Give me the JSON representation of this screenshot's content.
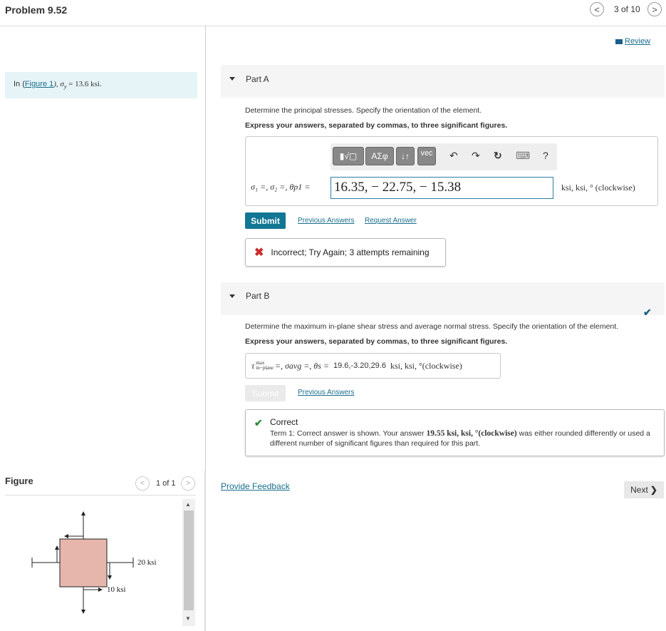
{
  "header": {
    "title": "Problem 9.52",
    "page_count": "3 of 10",
    "prev_glyph": "<",
    "next_glyph": ">"
  },
  "intro": {
    "prefix": "In (",
    "figure_link": "Figure 1",
    "suffix": "), σ",
    "sub": "y",
    "value": " = 13.6 ksi."
  },
  "review_link": "Review",
  "part_a": {
    "label": "Part A",
    "question": "Determine the principal stresses. Specify the orientation of the element.",
    "instruction": "Express your answers, separated by commas, to three significant figures.",
    "toolbar": {
      "template_btn": "▮√▢",
      "greek_btn": "ΑΣφ",
      "arrows_btn": "↓↑",
      "vec_btn": "vec",
      "undo": "↶",
      "redo": "↷",
      "reset": "↻",
      "keyboard": "⌨",
      "help": "?"
    },
    "equation_label": "σ₁ =, σ₂ =, θp1 =",
    "answer_value": "16.35, − 22.75, − 15.38",
    "units": "ksi, ksi, ° (clockwise)",
    "submit_label": "Submit",
    "previous_answers": "Previous Answers",
    "request_answer": "Request Answer",
    "feedback": "Incorrect; Try Again; 3 attempts remaining"
  },
  "part_b": {
    "label": "Part B",
    "question": "Determine the maximum in-plane shear stress and average normal stress. Specify the orientation of the element.",
    "instruction": "Express your answers, separated by commas, to three significant figures.",
    "equation_tau": "τ",
    "equation_sup": "max",
    "equation_sub": "in−plane",
    "equation_rest": "=, σavg =, θs =",
    "answer_value": "19.6,-3.20,29.6",
    "units": "ksi, ksi, °(clockwise)",
    "submit_label": "Submit",
    "previous_answers": "Previous Answers",
    "result_title": "Correct",
    "result_detail_1": "Term 1: Correct answer is shown. Your answer ",
    "result_detail_value": "19.55 ksi, ksi, °(clockwise)",
    "result_detail_2": " was either rounded differently or used a different number of significant figures than required for this part."
  },
  "provide_feedback": "Provide Feedback",
  "next_button": "Next",
  "figure": {
    "header": "Figure",
    "count": "1 of 1",
    "label_right": "20 ksi",
    "label_bottom": "10 ksi"
  },
  "colors": {
    "accent": "#117794",
    "element_fill": "#e6b6ad",
    "intro_bg": "#e6f4f7",
    "error": "#c82d2d",
    "success": "#2d8a3a"
  }
}
